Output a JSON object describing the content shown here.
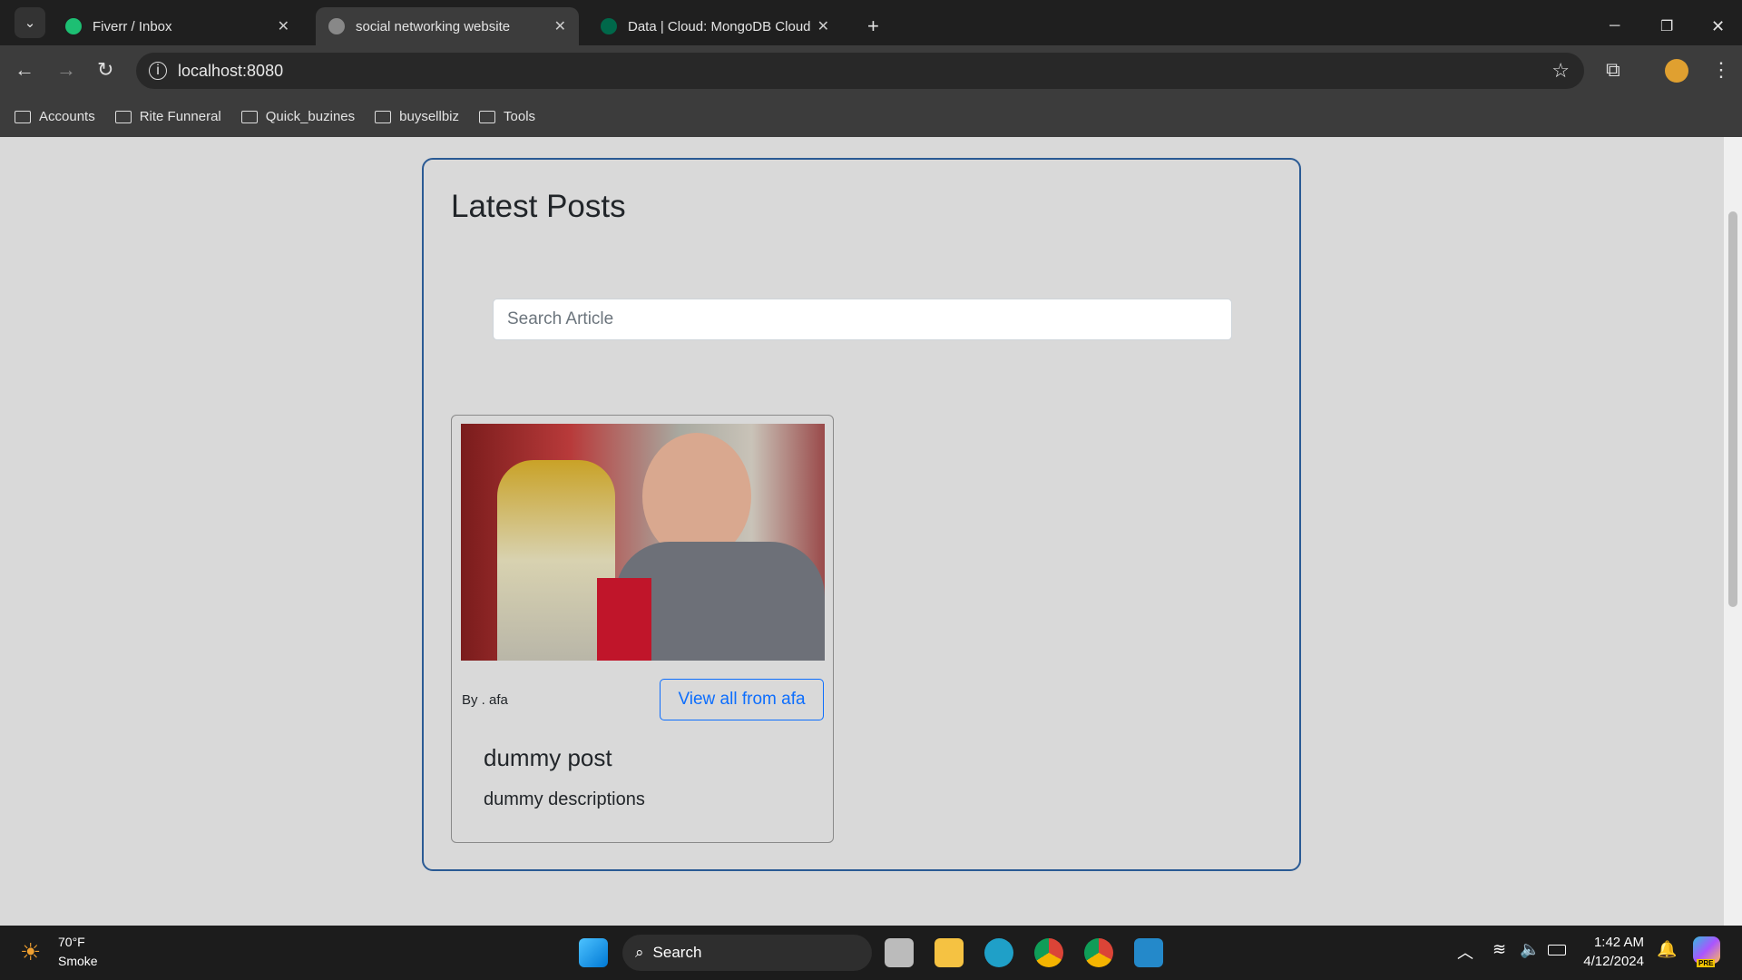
{
  "browser": {
    "tabs": [
      {
        "title": "Fiverr / Inbox",
        "active": false
      },
      {
        "title": "social networking website",
        "active": true
      },
      {
        "title": "Data | Cloud: MongoDB Cloud",
        "active": false
      }
    ],
    "new_tab": "+",
    "url": "localhost:8080",
    "bookmarks": [
      "Accounts",
      "Rite Funneral",
      "Quick_buzines",
      "buysellbiz",
      "Tools"
    ]
  },
  "page": {
    "title": "Latest Posts",
    "search_placeholder": "Search Article",
    "posts": [
      {
        "author_line": "By . afa",
        "view_all_label": "View all from afa",
        "title": "dummy post",
        "description": "dummy descriptions"
      }
    ]
  },
  "taskbar": {
    "weather_temp": "70°F",
    "weather_desc": "Smoke",
    "search_label": "Search",
    "time": "1:42 AM",
    "date": "4/12/2024",
    "copilot_badge": "PRE"
  },
  "colors": {
    "accent": "#0d6efd",
    "container_border": "#2a5a94"
  }
}
